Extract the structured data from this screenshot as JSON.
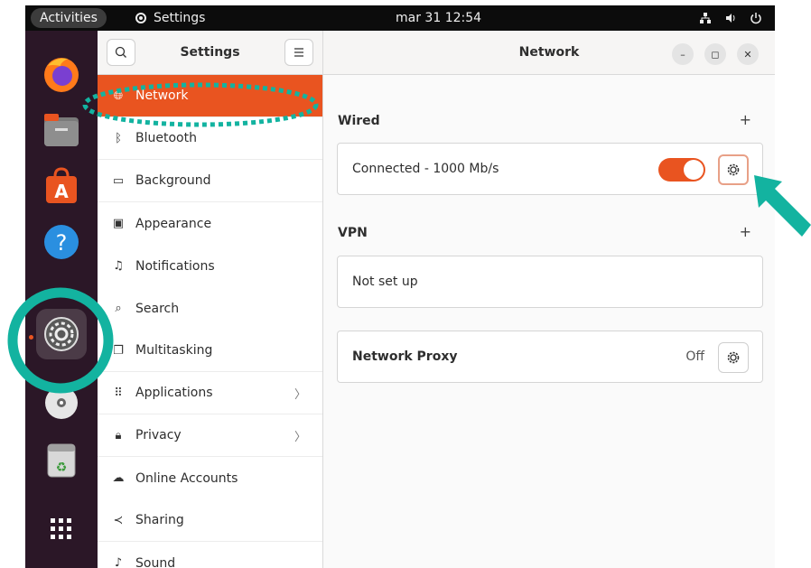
{
  "topbar": {
    "activities": "Activities",
    "app_name": "Settings",
    "clock": "mar 31  12:54"
  },
  "dock": {
    "items": [
      "firefox-icon",
      "files-icon",
      "software-icon",
      "help-icon",
      "settings-icon",
      "disc-icon",
      "trash-icon",
      "app-grid-icon"
    ]
  },
  "sidebar": {
    "title": "Settings",
    "items": [
      {
        "label": "Network",
        "icon": "globe-icon"
      },
      {
        "label": "Bluetooth",
        "icon": "bluetooth-icon"
      },
      {
        "label": "Background",
        "icon": "monitor-icon"
      },
      {
        "label": "Appearance",
        "icon": "appearance-icon"
      },
      {
        "label": "Notifications",
        "icon": "bell-icon"
      },
      {
        "label": "Search",
        "icon": "search-icon"
      },
      {
        "label": "Multitasking",
        "icon": "multitasking-icon"
      },
      {
        "label": "Applications",
        "icon": "apps-icon"
      },
      {
        "label": "Privacy",
        "icon": "lock-icon"
      },
      {
        "label": "Online Accounts",
        "icon": "cloud-icon"
      },
      {
        "label": "Sharing",
        "icon": "share-icon"
      },
      {
        "label": "Sound",
        "icon": "music-icon"
      }
    ]
  },
  "main": {
    "title": "Network",
    "wired": {
      "label": "Wired",
      "add": "+",
      "status": "Connected - 1000 Mb/s",
      "enabled": true
    },
    "vpn": {
      "label": "VPN",
      "add": "+",
      "status": "Not set up"
    },
    "proxy": {
      "label": "Network Proxy",
      "state": "Off"
    }
  },
  "colors": {
    "accent": "#e95420",
    "annotation": "#13b3a0",
    "dock": "#2b1727",
    "topbar": "#0c0c0c"
  }
}
